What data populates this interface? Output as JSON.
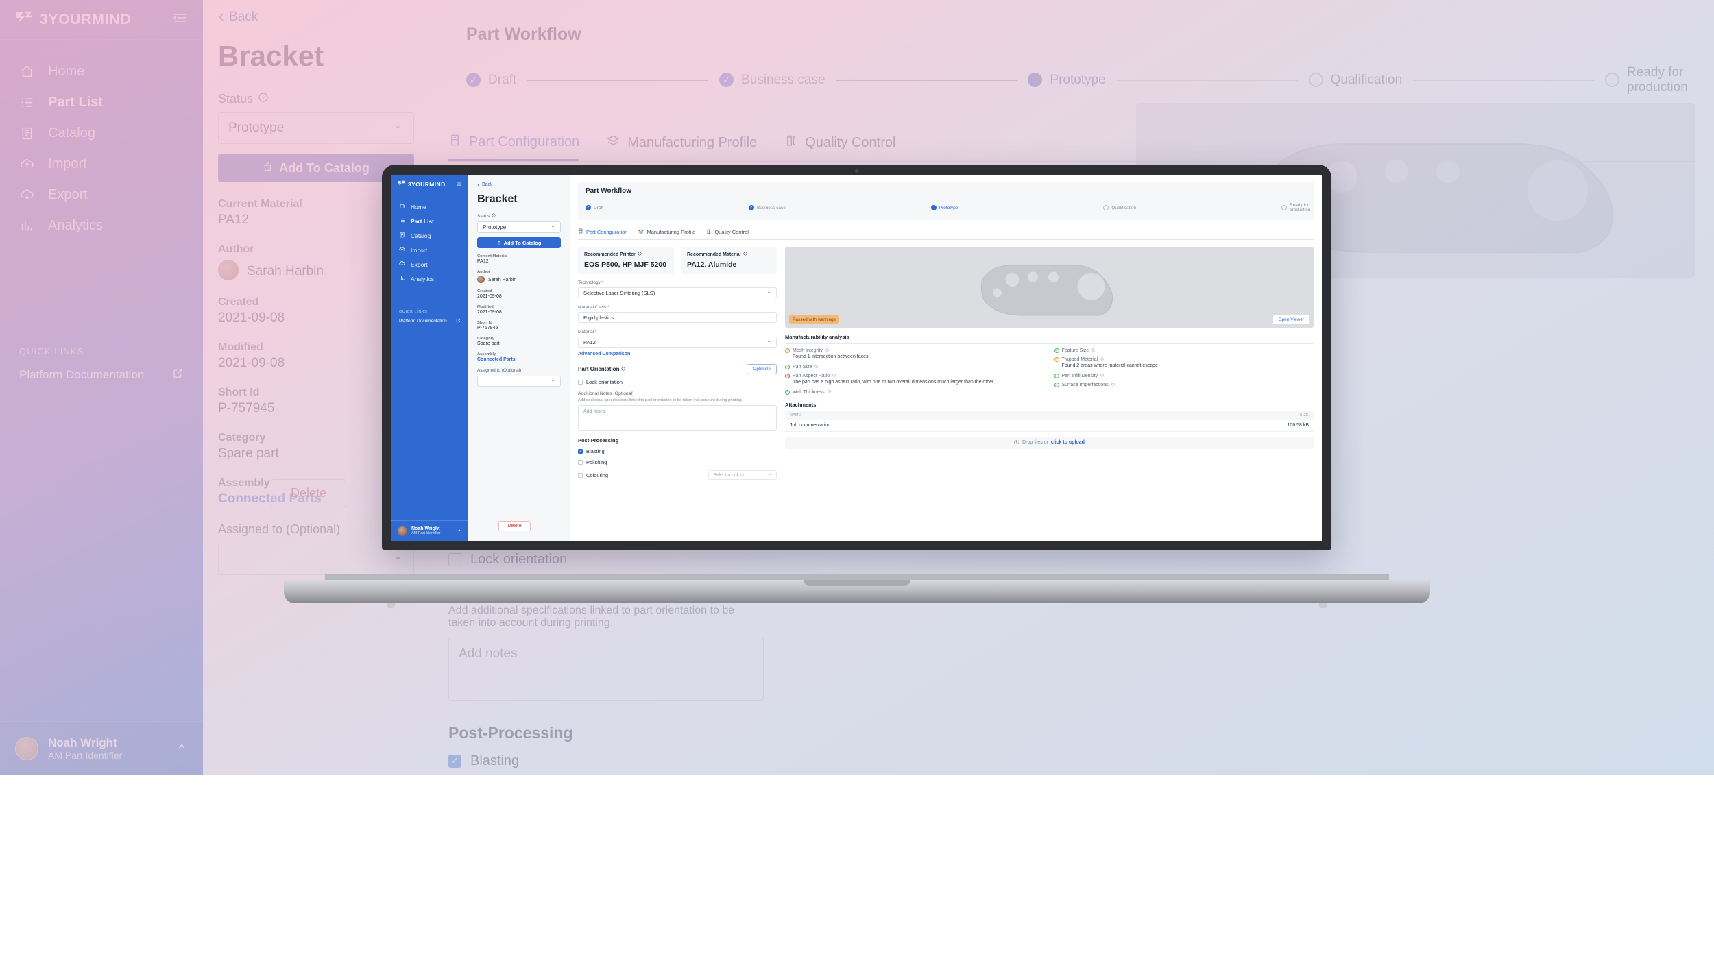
{
  "brand": {
    "mark": "3Y",
    "name": "3YOURMIND"
  },
  "sidebar": {
    "items": [
      {
        "label": "Home",
        "icon": "home-icon"
      },
      {
        "label": "Part List",
        "icon": "list-icon"
      },
      {
        "label": "Catalog",
        "icon": "catalog-icon"
      },
      {
        "label": "Import",
        "icon": "cloud-upload-icon"
      },
      {
        "label": "Export",
        "icon": "cloud-download-icon"
      },
      {
        "label": "Analytics",
        "icon": "analytics-icon"
      }
    ],
    "quick_links_title": "QUICK LINKS",
    "quick_link": "Platform Documentation",
    "user": {
      "name": "Noah Wright",
      "role": "AM Part Identifier"
    }
  },
  "detail": {
    "back": "Back",
    "title": "Bracket",
    "status_label": "Status",
    "status_value": "Prototype",
    "add_to_catalog": "Add To Catalog",
    "meta": [
      {
        "key": "Current Material",
        "value": "PA12"
      },
      {
        "key": "Created",
        "value": "2021-09-08"
      },
      {
        "key": "Modified",
        "value": "2021-09-08"
      },
      {
        "key": "Short Id",
        "value": "P-757945"
      },
      {
        "key": "Category",
        "value": "Spare part"
      }
    ],
    "author_label": "Author",
    "author_name": "Sarah Harbin",
    "assembly_label": "Assembly",
    "assembly_value": "Connected Parts",
    "assigned_label": "Assigned to (Optional)",
    "delete": "Delete"
  },
  "workflow": {
    "title": "Part Workflow",
    "steps": [
      {
        "label": "Draft",
        "state": "done"
      },
      {
        "label": "Business case",
        "state": "done"
      },
      {
        "label": "Prototype",
        "state": "current"
      },
      {
        "label": "Qualification",
        "state": "todo"
      },
      {
        "label": "Ready for production",
        "state": "todo"
      }
    ]
  },
  "tabs": [
    {
      "label": "Part Configuration",
      "icon": "part-config-icon",
      "active": true
    },
    {
      "label": "Manufacturing Profile",
      "icon": "layers-icon",
      "active": false
    },
    {
      "label": "Quality Control",
      "icon": "caliper-icon",
      "active": false
    }
  ],
  "recommendations": [
    {
      "label": "Recommended Printer",
      "value": "EOS P500, HP MJF 5200"
    },
    {
      "label": "Recommended Material",
      "value": "PA12, Alumide"
    }
  ],
  "form": {
    "technology_label": "Technology *",
    "technology_value": "Selective Laser Sintering (SLS)",
    "material_class_label": "Material Class *",
    "material_class_value": "Rigid plastics",
    "material_label": "Material *",
    "material_value": "PA12",
    "advanced_comparison": "Advanced Comparison",
    "part_orientation": "Part Orientation",
    "optimize": "Optimize",
    "lock_orientation": "Lock orientation",
    "notes_label": "Additional Notes",
    "notes_optional": " (Optional)",
    "notes_hint": "Add additional specifications linked to part orientation to be taken into account during printing.",
    "notes_placeholder": "Add notes",
    "post_processing": "Post-Processing",
    "options": [
      {
        "label": "Blasting",
        "checked": true
      },
      {
        "label": "Polishing",
        "checked": false
      },
      {
        "label": "Colouring",
        "checked": false
      }
    ],
    "colour_placeholder": "Select a colour"
  },
  "viewer": {
    "badge": "Passed with warnings",
    "open_viewer": "Open Viewer"
  },
  "manufacturability": {
    "title": "Manufacturability analysis",
    "left": [
      {
        "name": "Mesh Integrity",
        "status": "warn",
        "desc": "Found 1 intersection between faces."
      },
      {
        "name": "Part Size",
        "status": "ok",
        "desc": ""
      },
      {
        "name": "Part Aspect Ratio",
        "status": "err",
        "desc": "The part has a high aspect ratio, with one or two overall dimensions much larger than the other."
      },
      {
        "name": "Wall Thickness",
        "status": "ok",
        "desc": ""
      }
    ],
    "right": [
      {
        "name": "Feature Size",
        "status": "ok",
        "desc": ""
      },
      {
        "name": "Trapped Material",
        "status": "warn",
        "desc": "Found 2 areas where material cannot escape"
      },
      {
        "name": "Part Infill Density",
        "status": "ok",
        "desc": ""
      },
      {
        "name": "Surface Imperfactions",
        "status": "ok",
        "desc": ""
      }
    ]
  },
  "attachments": {
    "title": "Attachments",
    "col_name": "NAME",
    "col_size": "SIZE",
    "rows": [
      {
        "name": "Job documentation",
        "size": "106.58 kB"
      }
    ],
    "drop_text": "Drop files or ",
    "drop_link": "click to upload"
  },
  "colors": {
    "brand_blue": "#2e6ad1",
    "sidebar_gradient_start": "#6a63c0",
    "sidebar_gradient_end": "#2f62cd",
    "warning_badge_bg": "#f5b878",
    "status_ok": "#4caf50",
    "status_warn": "#f0922b",
    "status_error": "#e14040"
  }
}
